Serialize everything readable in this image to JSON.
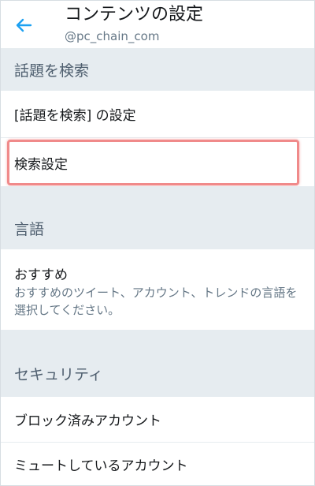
{
  "header": {
    "title": "コンテンツの設定",
    "account": "@pc_chain_com",
    "back_icon": "arrow-left-icon",
    "accent_color": "#1da1f2"
  },
  "sections": {
    "explore": {
      "title": "話題を検索",
      "items": [
        {
          "label": "[話題を検索] の設定"
        },
        {
          "label": "検索設定",
          "highlighted": true
        }
      ]
    },
    "language": {
      "title": "言語",
      "recommendations": {
        "label": "おすすめ",
        "description": "おすすめのツイート、アカウント、トレンドの言語を選択してください。"
      }
    },
    "security": {
      "title": "セキュリティ",
      "items": [
        {
          "label": "ブロック済みアカウント"
        },
        {
          "label": "ミュートしているアカウント"
        }
      ]
    }
  },
  "colors": {
    "section_background": "#e6ecf0",
    "highlight_border": "#f08a8a"
  }
}
